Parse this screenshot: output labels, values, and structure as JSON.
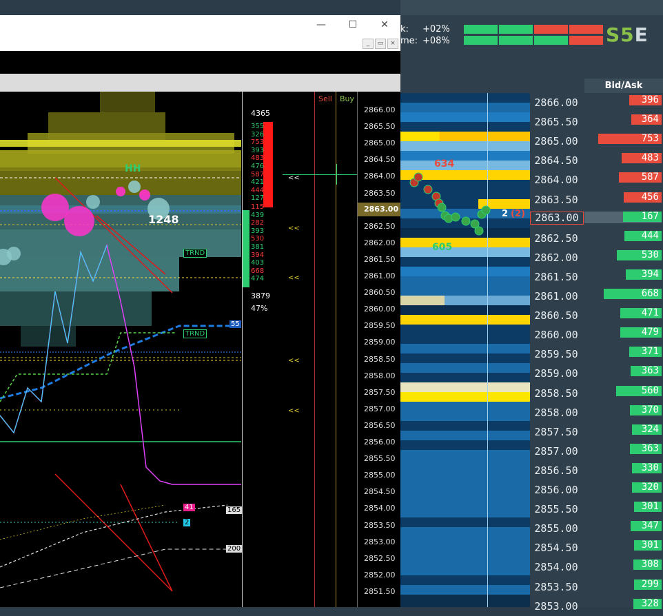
{
  "top_metrics": [
    {
      "label": "k:",
      "value": "+02%"
    },
    {
      "label": "me:",
      "value": "+08%"
    }
  ],
  "meter_rows": [
    [
      "#2ecc71",
      "#2ecc71",
      "#e74c3c",
      "#e74c3c"
    ],
    [
      "#2ecc71",
      "#2ecc71",
      "#2ecc71",
      "#e74c3c"
    ]
  ],
  "logo": {
    "text": "S5",
    "suffix": "E",
    "colors": {
      "s": "#8bc34a",
      "five": "#cfd8dc"
    }
  },
  "window_controls": {
    "minimize": "—",
    "maximize": "☐",
    "close": "✕"
  },
  "mdi_controls": {
    "minimize": "_",
    "restore": "▭",
    "close": "×"
  },
  "ladder": {
    "header": "Bid/Ask",
    "current_price": "2863.00",
    "rows": [
      {
        "price": "2866.00",
        "qty": "396",
        "side": "ask",
        "frac": 0.42
      },
      {
        "price": "2865.50",
        "qty": "364",
        "side": "ask",
        "frac": 0.39
      },
      {
        "price": "2865.00",
        "qty": "753",
        "side": "ask",
        "frac": 0.82
      },
      {
        "price": "2864.50",
        "qty": "483",
        "side": "ask",
        "frac": 0.52
      },
      {
        "price": "2864.00",
        "qty": "587",
        "side": "ask",
        "frac": 0.55
      },
      {
        "price": "2863.50",
        "qty": "456",
        "side": "ask",
        "frac": 0.49
      },
      {
        "price": "2863.00",
        "qty": "167",
        "side": "bid",
        "frac": 0.0
      },
      {
        "price": "2862.50",
        "qty": "444",
        "side": "bid",
        "frac": 0.48
      },
      {
        "price": "2862.00",
        "qty": "530",
        "side": "bid",
        "frac": 0.58
      },
      {
        "price": "2861.50",
        "qty": "394",
        "side": "bid",
        "frac": 0.46
      },
      {
        "price": "2861.00",
        "qty": "668",
        "side": "bid",
        "frac": 0.75
      },
      {
        "price": "2860.50",
        "qty": "471",
        "side": "bid",
        "frac": 0.54
      },
      {
        "price": "2860.00",
        "qty": "479",
        "side": "bid",
        "frac": 0.54
      },
      {
        "price": "2859.50",
        "qty": "371",
        "side": "bid",
        "frac": 0.42
      },
      {
        "price": "2859.00",
        "qty": "363",
        "side": "bid",
        "frac": 0.4
      },
      {
        "price": "2858.50",
        "qty": "560",
        "side": "bid",
        "frac": 0.59
      },
      {
        "price": "2858.00",
        "qty": "370",
        "side": "bid",
        "frac": 0.41
      },
      {
        "price": "2857.50",
        "qty": "324",
        "side": "bid",
        "frac": 0.38
      },
      {
        "price": "2857.00",
        "qty": "363",
        "side": "bid",
        "frac": 0.41
      },
      {
        "price": "2856.50",
        "qty": "330",
        "side": "bid",
        "frac": 0.38
      },
      {
        "price": "2856.00",
        "qty": "320",
        "side": "bid",
        "frac": 0.38
      },
      {
        "price": "2855.50",
        "qty": "301",
        "side": "bid",
        "frac": 0.36
      },
      {
        "price": "2855.00",
        "qty": "347",
        "side": "bid",
        "frac": 0.4
      },
      {
        "price": "2854.50",
        "qty": "301",
        "side": "bid",
        "frac": 0.36
      },
      {
        "price": "2854.00",
        "qty": "308",
        "side": "bid",
        "frac": 0.37
      },
      {
        "price": "2853.50",
        "qty": "299",
        "side": "bid",
        "frac": 0.36
      },
      {
        "price": "2853.00",
        "qty": "328",
        "side": "bid",
        "frac": 0.37
      }
    ]
  },
  "heatmap_labels": {
    "upper": "634",
    "lower": "605",
    "position": "2",
    "position_paren": "(2)"
  },
  "chart": {
    "sell_label": "Sell",
    "buy_label": "Buy",
    "price_ticks": [
      "2866.00",
      "2865.50",
      "2865.00",
      "2864.50",
      "2864.00",
      "2863.50",
      "2863.00",
      "2862.50",
      "2862.00",
      "2861.50",
      "2861.00",
      "2860.50",
      "2860.00",
      "2859.50",
      "2859.00",
      "2858.50",
      "2858.00",
      "2857.50",
      "2857.00",
      "2856.50",
      "2856.00",
      "2855.50",
      "2855.00",
      "2854.50",
      "2854.00",
      "2853.50",
      "2853.00",
      "2852.50",
      "2852.00",
      "2851.50"
    ],
    "highlight_price": "2863.00",
    "vol_total_top": "4365",
    "vol_total_bottom": "3879",
    "vol_percent": "47%",
    "sell_vols": [
      "355",
      "326",
      "753",
      "393",
      "483",
      "476",
      "587",
      "421",
      "444",
      "127"
    ],
    "buy_vols": [
      "115",
      "439",
      "282",
      "393",
      "530",
      "381",
      "394",
      "403",
      "668",
      "474"
    ],
    "hh_label": "HH",
    "trade_label": "1248",
    "trnd_label": "TRND",
    "trnd_label_2": "TRND",
    "level_55": "55",
    "level_41": "41",
    "level_2": "2",
    "level_165": "165",
    "level_200": "200",
    "arrows": "<<"
  }
}
